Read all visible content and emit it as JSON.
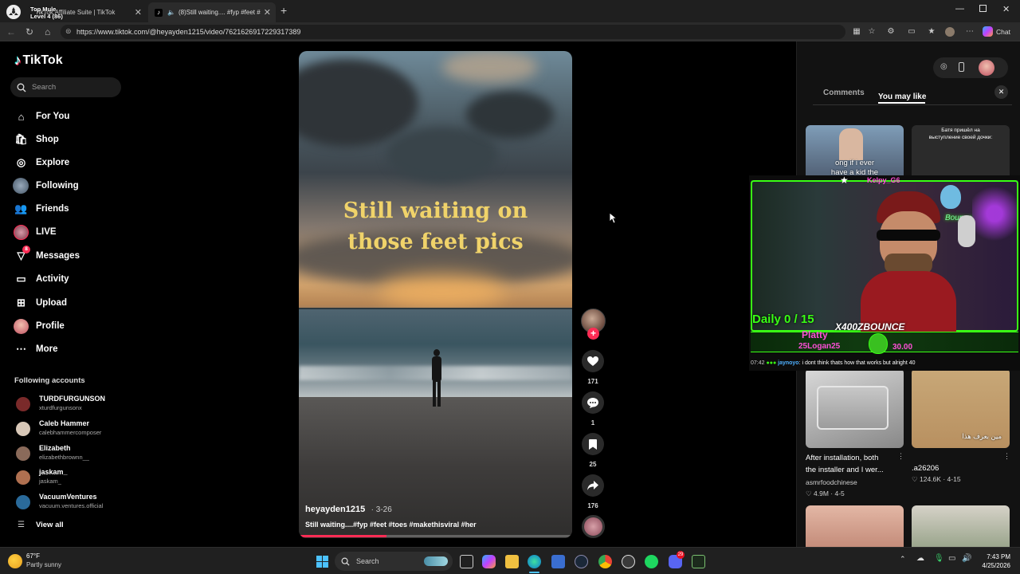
{
  "browser": {
    "tabs": [
      {
        "title": "TikTok Affiliate Suite | TikTok",
        "active": false
      },
      {
        "title": "(8)Still waiting.... #fyp #feet #",
        "active": true
      }
    ],
    "notification_overlay": {
      "line1": "Top Mule",
      "line2": "Level 4  (86)"
    },
    "url": "https://www.tiktok.com/@heyayden1215/video/7621626917229317389",
    "chat_label": "Chat"
  },
  "sidebar": {
    "logo": "TikTok",
    "search_placeholder": "Search",
    "nav": [
      {
        "label": "For You",
        "icon": "home-icon"
      },
      {
        "label": "Shop",
        "icon": "shop-icon"
      },
      {
        "label": "Explore",
        "icon": "compass-icon"
      },
      {
        "label": "Following",
        "icon": "following-avatar-icon"
      },
      {
        "label": "Friends",
        "icon": "friends-icon"
      },
      {
        "label": "LIVE",
        "icon": "live-icon"
      },
      {
        "label": "Messages",
        "icon": "messages-icon",
        "badge": "8"
      },
      {
        "label": "Activity",
        "icon": "activity-icon"
      },
      {
        "label": "Upload",
        "icon": "upload-icon"
      },
      {
        "label": "Profile",
        "icon": "profile-avatar-icon"
      },
      {
        "label": "More",
        "icon": "more-icon"
      }
    ],
    "following_title": "Following accounts",
    "accounts": [
      {
        "name": "TURDFURGUNSON",
        "handle": "xturdfurgunsonx"
      },
      {
        "name": "Caleb Hammer",
        "handle": "calebhammercomposer"
      },
      {
        "name": "Elizabeth",
        "handle": "elizabethbrownn__"
      },
      {
        "name": "jaskam_",
        "handle": "jaskam_"
      },
      {
        "name": "VacuumVentures",
        "handle": "vacuum.ventures.official"
      }
    ],
    "view_all": "View all"
  },
  "video": {
    "caption_line1": "Still waiting on",
    "caption_line2": "those feet pics",
    "author": "heyayden1215",
    "date": "· 3-26",
    "description": "Still waiting....#fyp #feet #toes #makethisviral #her",
    "progress": 0.32
  },
  "actions": {
    "likes": "171",
    "comments": "1",
    "saves": "25",
    "shares": "176"
  },
  "right_panel": {
    "tabs": [
      "Comments",
      "You may like"
    ],
    "active_tab": "You may like",
    "top_thumbs": [
      {
        "text_line1": "ong if i ever",
        "text_line2": "have a kid the"
      },
      {
        "text_line1": "Батя пришёл на",
        "text_line2": "выступление своей дочки:"
      }
    ],
    "videos": [
      {
        "title_line1": "After installation, both",
        "title_line2": "the installer and I wer...",
        "author": "asmrfoodchinese",
        "likes": "4.9M",
        "date": "4-5"
      },
      {
        "title_line1": ".a26206",
        "title_line2": "",
        "author": "",
        "likes": "124.6K",
        "date": "4-15",
        "thumb_text": "مين بعرف هذا"
      }
    ]
  },
  "stream_overlay": {
    "top_name": "Kelpy_G6",
    "daily": "Daily 0 / 15",
    "streamer": "X400ZBOUNCE",
    "sub1": "Platty",
    "sub2": "25Logan25",
    "amount": "30.00",
    "neon_sign": "Bounce",
    "chat_time": "07:42",
    "chat_user": "jaynoyo",
    "chat_message": "i dont think thats how that works but alright 40"
  },
  "taskbar": {
    "weather_temp": "67°F",
    "weather_desc": "Partly sunny",
    "search": "Search",
    "time": "7:43 PM",
    "date": "4/25/2026",
    "discord_badge": "29"
  },
  "colors": {
    "tiktok_pink": "#fe2c55",
    "caption_gold": "#f0d36a",
    "overlay_green": "#39ff14"
  }
}
